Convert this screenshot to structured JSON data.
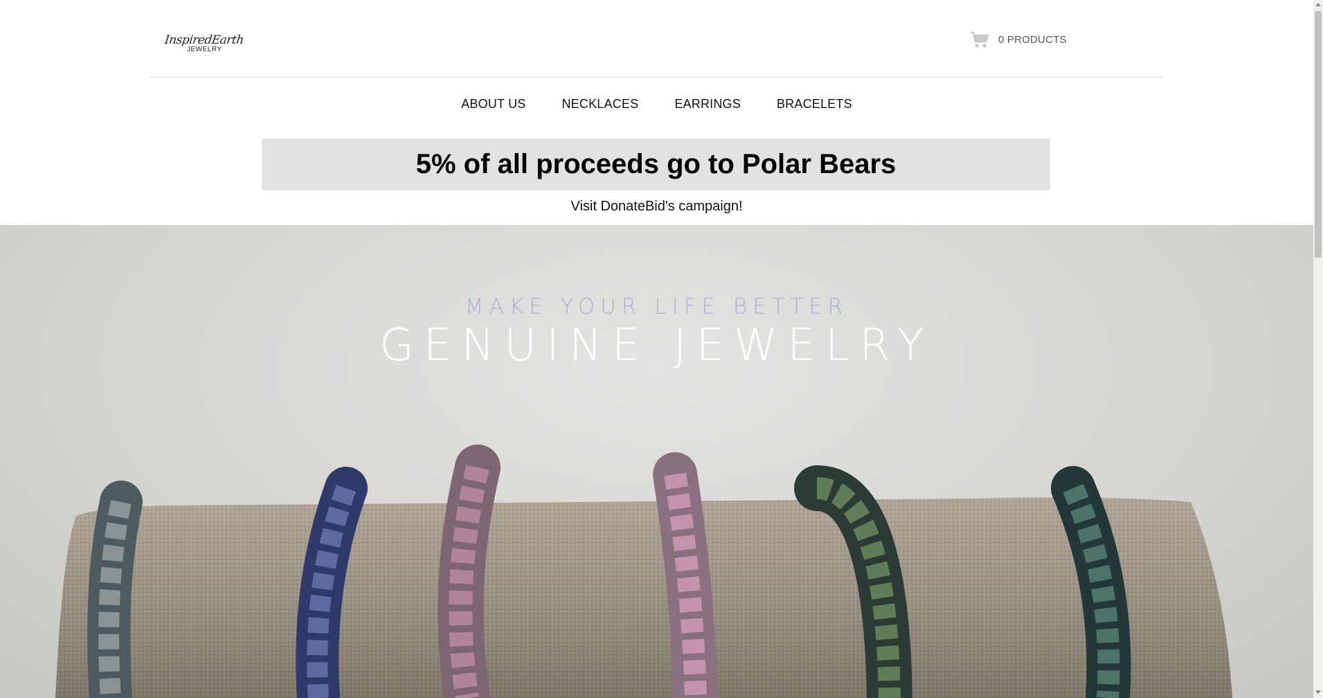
{
  "header": {
    "logo": {
      "script": "InspiredEarth",
      "sub": "JEWELRY"
    },
    "cart": {
      "label": "0 PRODUCTS",
      "icon": "cart-icon"
    }
  },
  "nav": {
    "items": [
      {
        "label": "ABOUT US"
      },
      {
        "label": "NECKLACES"
      },
      {
        "label": "EARRINGS"
      },
      {
        "label": "BRACELETS"
      }
    ]
  },
  "promo": {
    "headline": "5% of all proceeds go to Polar Bears",
    "link_text": "Visit DonateBid's campaign!"
  },
  "hero": {
    "subtitle": "MAKE YOUR LIFE BETTER",
    "title": "GENUINE JEWELRY",
    "image": "beaded-bracelets-on-linen-display"
  }
}
